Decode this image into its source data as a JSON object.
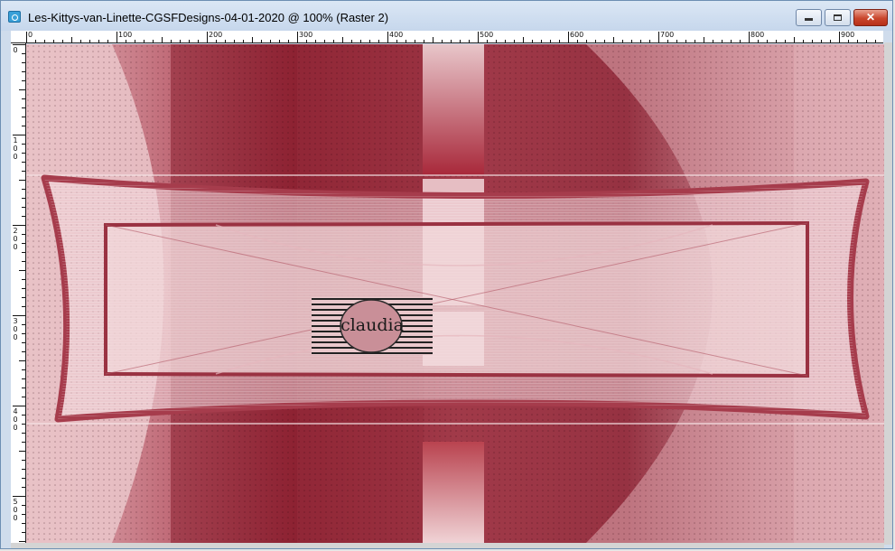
{
  "window": {
    "title": "Les-Kittys-van-Linette-CGSFDesigns-04-01-2020 @ 100% (Raster 2)",
    "app_icon": "paint-shop-pro-icon",
    "controls": {
      "minimize": "minimize-icon",
      "maximize": "maximize-icon",
      "close_label": "✕"
    }
  },
  "ruler": {
    "top_labels": [
      "0",
      "100",
      "200",
      "300",
      "400",
      "500",
      "600",
      "700",
      "800",
      "900"
    ],
    "left_labels": [
      [
        "0"
      ],
      [
        "1",
        "0",
        "0"
      ],
      [
        "2",
        "0",
        "0"
      ],
      [
        "3",
        "0",
        "0"
      ],
      [
        "4",
        "0",
        "0"
      ],
      [
        "5",
        "0",
        "0"
      ]
    ]
  },
  "canvas": {
    "watermark": "claudia",
    "colors": {
      "dark": "#8e2231",
      "mid": "#a63c4c",
      "light": "#e9c2c6",
      "pale": "#f3dadd"
    }
  }
}
